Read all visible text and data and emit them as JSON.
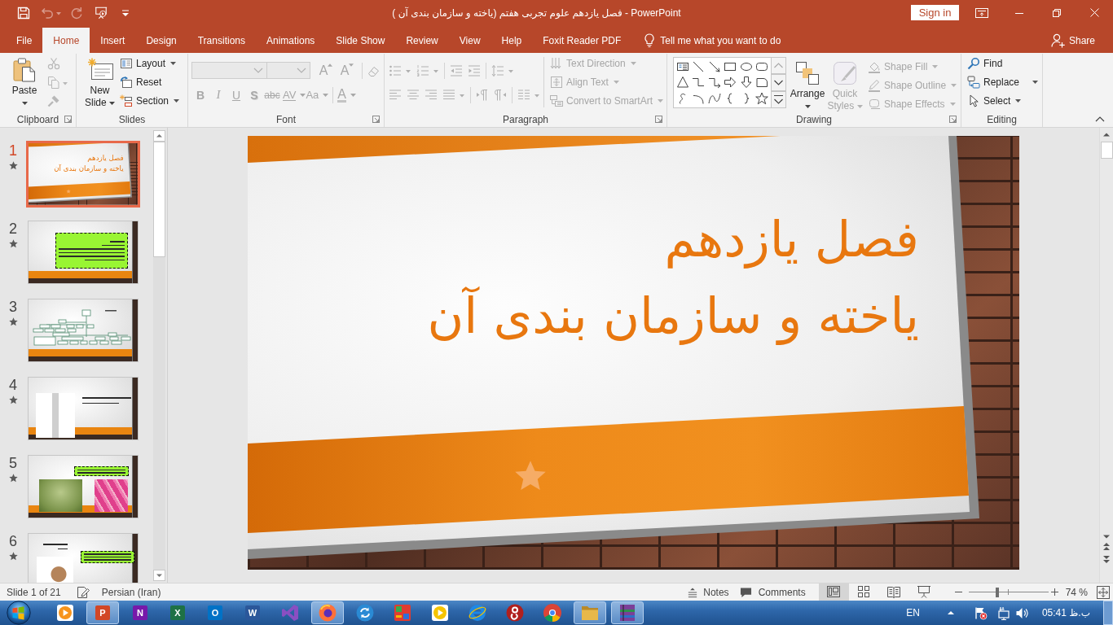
{
  "window": {
    "title": "فصل یازدهم علوم تجربی هفتم (یاخته و سازمان بندی آن )  -  PowerPoint",
    "sign_in": "Sign in"
  },
  "quick_access": [
    {
      "kind": "save",
      "disabled": false
    },
    {
      "kind": "undo",
      "disabled": true
    },
    {
      "kind": "redo",
      "disabled": true
    },
    {
      "kind": "present",
      "disabled": false
    },
    {
      "kind": "customize",
      "disabled": false
    }
  ],
  "tabs": [
    {
      "label": "File",
      "selected": false
    },
    {
      "label": "Home",
      "selected": true
    },
    {
      "label": "Insert",
      "selected": false
    },
    {
      "label": "Design",
      "selected": false
    },
    {
      "label": "Transitions",
      "selected": false
    },
    {
      "label": "Animations",
      "selected": false
    },
    {
      "label": "Slide Show",
      "selected": false
    },
    {
      "label": "Review",
      "selected": false
    },
    {
      "label": "View",
      "selected": false
    },
    {
      "label": "Help",
      "selected": false
    },
    {
      "label": "Foxit Reader PDF",
      "selected": false
    }
  ],
  "tell_me": {
    "placeholder": "Tell me what you want to do"
  },
  "share": "Share",
  "ribbon": {
    "clipboard": {
      "label": "Clipboard",
      "paste": "Paste",
      "tools": [
        {
          "kind": "cut",
          "disabled": true
        },
        {
          "kind": "copy",
          "disabled": true
        },
        {
          "kind": "format-painter",
          "disabled": true
        }
      ]
    },
    "slides": {
      "label": "Slides",
      "new_slide": "New Slide",
      "commands": [
        {
          "kind": "layout",
          "label": "Layout",
          "dropdown": true
        },
        {
          "kind": "reset",
          "label": "Reset",
          "dropdown": false
        },
        {
          "kind": "section",
          "label": "Section",
          "dropdown": true
        }
      ]
    },
    "font": {
      "label": "Font",
      "disabled": true,
      "size_buttons": [
        {
          "kind": "grow",
          "label": "A"
        },
        {
          "kind": "shrink",
          "label": "A"
        }
      ],
      "format_buttons": [
        {
          "kind": "bold",
          "label": "B",
          "dropdown": false
        },
        {
          "kind": "italic",
          "label": "I",
          "dropdown": false
        },
        {
          "kind": "underline",
          "label": "U",
          "dropdown": false
        },
        {
          "kind": "shadow",
          "label": "S",
          "dropdown": false
        },
        {
          "kind": "strikethrough",
          "label": "abc",
          "dropdown": false
        },
        {
          "kind": "spacing",
          "label": "AV",
          "dropdown": true
        },
        {
          "kind": "case",
          "label": "Aa",
          "dropdown": true
        },
        {
          "kind": "color",
          "label": "A",
          "dropdown": true
        }
      ]
    },
    "paragraph": {
      "label": "Paragraph",
      "disabled": true,
      "commands": [
        {
          "kind": "text-direction",
          "label": "Text Direction",
          "dropdown": true
        },
        {
          "kind": "align-text",
          "label": "Align Text",
          "dropdown": true
        },
        {
          "kind": "smartart",
          "label": "Convert to SmartArt",
          "dropdown": true
        }
      ]
    },
    "drawing": {
      "label": "Drawing",
      "shapes": [
        {
          "kind": "text-box"
        },
        {
          "kind": "line"
        },
        {
          "kind": "line-arrow"
        },
        {
          "kind": "rectangle"
        },
        {
          "kind": "oval"
        },
        {
          "kind": "rounded-rectangle"
        },
        {
          "kind": "triangle"
        },
        {
          "kind": "elbow-connector"
        },
        {
          "kind": "elbow-arrow"
        },
        {
          "kind": "right-arrow"
        },
        {
          "kind": "down-arrow"
        },
        {
          "kind": "snip-rectangle"
        },
        {
          "kind": "freeform"
        },
        {
          "kind": "arc"
        },
        {
          "kind": "curve"
        },
        {
          "kind": "left-brace"
        },
        {
          "kind": "right-brace"
        },
        {
          "kind": "star"
        }
      ],
      "arrange": "Arrange",
      "quick_styles": {
        "label": "Quick Styles",
        "disabled": true
      },
      "commands": [
        {
          "kind": "fill",
          "label": "Shape Fill",
          "disabled": true,
          "dropdown": true
        },
        {
          "kind": "outline",
          "label": "Shape Outline",
          "disabled": true,
          "dropdown": true
        },
        {
          "kind": "effects",
          "label": "Shape Effects",
          "disabled": true,
          "dropdown": true
        }
      ]
    },
    "editing": {
      "label": "Editing",
      "commands": [
        {
          "kind": "find",
          "label": "Find",
          "dropdown": false
        },
        {
          "kind": "replace",
          "label": "Replace",
          "dropdown": true
        },
        {
          "kind": "select",
          "label": "Select",
          "dropdown": true
        }
      ]
    }
  },
  "thumbnails": [
    {
      "number": "1",
      "selected": true,
      "animated": true,
      "kind": "title",
      "title": "فصل یازدهم",
      "subtitle": "یاخته و سازمان بندی آن"
    },
    {
      "number": "2",
      "selected": false,
      "animated": true,
      "kind": "text-box"
    },
    {
      "number": "3",
      "selected": false,
      "animated": true,
      "kind": "org-chart"
    },
    {
      "number": "4",
      "selected": false,
      "animated": true,
      "kind": "figure"
    },
    {
      "number": "5",
      "selected": false,
      "animated": true,
      "kind": "photos"
    },
    {
      "number": "6",
      "selected": false,
      "animated": true,
      "kind": "figure-text"
    }
  ],
  "slide": {
    "title": "فصل یازدهم",
    "subtitle": "یاخته و سازمان بندی آن"
  },
  "status_bar": {
    "slide_position": "Slide 1 of 21",
    "language": "Persian (Iran)",
    "notes": "Notes",
    "comments": "Comments",
    "views": [
      {
        "kind": "normal",
        "selected": true
      },
      {
        "kind": "sorter",
        "selected": false
      },
      {
        "kind": "reading",
        "selected": false
      },
      {
        "kind": "slideshow",
        "selected": false
      }
    ],
    "zoom": {
      "level": 0.36,
      "reading": "74 %"
    }
  },
  "taskbar": {
    "apps": [
      {
        "kind": "play",
        "color": "#f7941d",
        "running": false
      },
      {
        "kind": "letter",
        "letter": "P",
        "color": "#d24726",
        "running": true
      },
      {
        "kind": "letter",
        "letter": "N",
        "color": "#7719aa",
        "running": false
      },
      {
        "kind": "letter",
        "letter": "X",
        "color": "#1e7145",
        "running": false
      },
      {
        "kind": "letter",
        "letter": "O",
        "color": "#0072c6",
        "running": false
      },
      {
        "kind": "letter",
        "letter": "W",
        "color": "#2b579a",
        "running": false
      },
      {
        "kind": "bowtie",
        "color": "#8a4fc2",
        "running": false
      },
      {
        "kind": "globe",
        "color": "#ff7139",
        "running": true
      },
      {
        "kind": "sync",
        "color": "#2a8ad4",
        "running": false
      },
      {
        "kind": "blocks",
        "color": "#e03c31",
        "running": false
      },
      {
        "kind": "play",
        "color": "#f5c400",
        "running": false
      },
      {
        "kind": "ring",
        "color": "#1e88e5",
        "running": false
      },
      {
        "kind": "swirl",
        "color": "#b0201e",
        "running": false
      },
      {
        "kind": "segments",
        "color": "#db4437",
        "running": false
      },
      {
        "kind": "folder",
        "color": "#e8b84a",
        "running": true
      },
      {
        "kind": "books",
        "color": "#7b3f98",
        "running": true
      }
    ],
    "language": "EN",
    "time": "05:41 ب.ظ"
  }
}
